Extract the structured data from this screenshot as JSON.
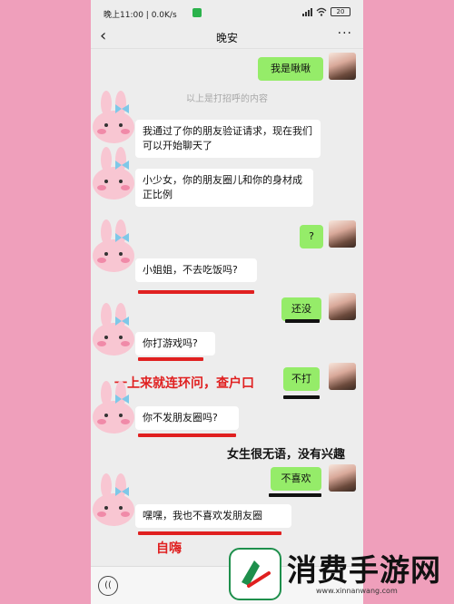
{
  "status_bar": {
    "time_speed": "晚上11:00 | 0.0K/s",
    "battery": "20"
  },
  "header": {
    "title": "晚安",
    "back_icon": "‹",
    "more_icon": "···"
  },
  "system_note": "以上是打招呼的内容",
  "messages": [
    {
      "side": "right",
      "text": "我是啾啾"
    },
    {
      "side": "left",
      "text": "我通过了你的朋友验证请求，现在我们可以开始聊天了"
    },
    {
      "side": "left",
      "text": "小少女，你的朋友圈儿和你的身材成正比例"
    },
    {
      "side": "right",
      "text": "?"
    },
    {
      "side": "left",
      "text": "小姐姐，不去吃饭吗?"
    },
    {
      "side": "right",
      "text": "还没"
    },
    {
      "side": "left",
      "text": "你打游戏吗?"
    },
    {
      "side": "right",
      "text": "不打"
    },
    {
      "side": "left",
      "text": "你不发朋友圈吗?"
    },
    {
      "side": "right",
      "text": "不喜欢"
    },
    {
      "side": "left",
      "text": "嘿嘿，我也不喜欢发朋友圈"
    }
  ],
  "annotations": {
    "interrogation": "一上来就连环问，查户口",
    "speechless": "女生很无语，没有兴趣",
    "self_praise": "自嗨"
  },
  "watermark": {
    "title": "消费手游网",
    "url": "www.xinnanwang.com",
    "colors": {
      "logo_green": "#1e8f4c",
      "text": "#111111"
    }
  },
  "colors": {
    "background": "#ef9fbb",
    "chat_bg": "#ededed",
    "bubble_right": "#95ec69",
    "bubble_left": "#ffffff",
    "annotation_red": "#e02020",
    "underline_black": "#111111"
  }
}
